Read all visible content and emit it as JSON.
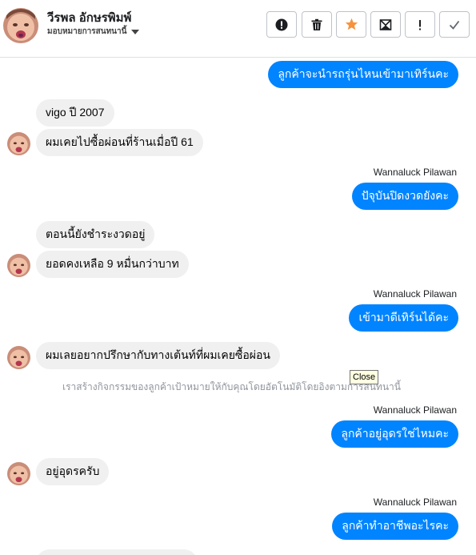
{
  "header": {
    "contact_name": "วีรพล อักษรพิมพ์",
    "assignment_label": "มอบหมายการสนทนานี้"
  },
  "toolbar": {
    "buttons": [
      {
        "icon": "alert-circle-icon",
        "label": ""
      },
      {
        "icon": "trash-icon",
        "label": ""
      },
      {
        "icon": "star-icon",
        "label": "",
        "color": "#f7923b"
      },
      {
        "icon": "archive-icon",
        "label": ""
      },
      {
        "icon": "exclamation-icon",
        "label": ""
      },
      {
        "icon": "checkmark-icon",
        "label": ""
      }
    ]
  },
  "messages": [
    {
      "direction": "out",
      "text": "ลูกค้าจะนำรถรุ่นไหนเข้ามาเทิร์นคะ"
    },
    {
      "direction": "in",
      "text": "vigo ปี 2007"
    },
    {
      "direction": "in",
      "text": "ผมเคยไปซื้อผ่อนที่ร้านเมื่อปี 61"
    },
    {
      "direction": "out",
      "sender": "Wannaluck Pilawan",
      "text": "ปัจุบันปิดงวดยังคะ"
    },
    {
      "direction": "in",
      "text": "ตอนนี้ยังชำระงวดอยู่"
    },
    {
      "direction": "in",
      "text": "ยอดคงเหลือ 9 หมื่นกว่าบาท"
    },
    {
      "direction": "out",
      "sender": "Wannaluck Pilawan",
      "text": "เข้ามาดีเทิร์นได้คะ"
    },
    {
      "direction": "in",
      "text": "ผมเลยอยากปรึกษากับทางเต้นท์ที่ผมเคยซื้อผ่อน"
    },
    {
      "direction": "out",
      "sender": "Wannaluck Pilawan",
      "text": "ลูกค้าอยู่อุดรใช่ไหมคะ"
    },
    {
      "direction": "in",
      "text": "อยู่อุดรครับ"
    },
    {
      "direction": "out",
      "sender": "Wannaluck Pilawan",
      "text": "ลูกค้าทำอาชีพอะไรคะ"
    }
  ],
  "system_note": "เราสร้างกิจกรรมของลูกค้าเป้าหมายให้กับคุณโดยอัตโนมัติโดยอิงตามการสนทนานี้",
  "tooltip": "Close",
  "colors": {
    "outgoing_bubble": "#0084ff",
    "incoming_bubble": "#f0f0f0",
    "star_accent": "#f7923b"
  }
}
